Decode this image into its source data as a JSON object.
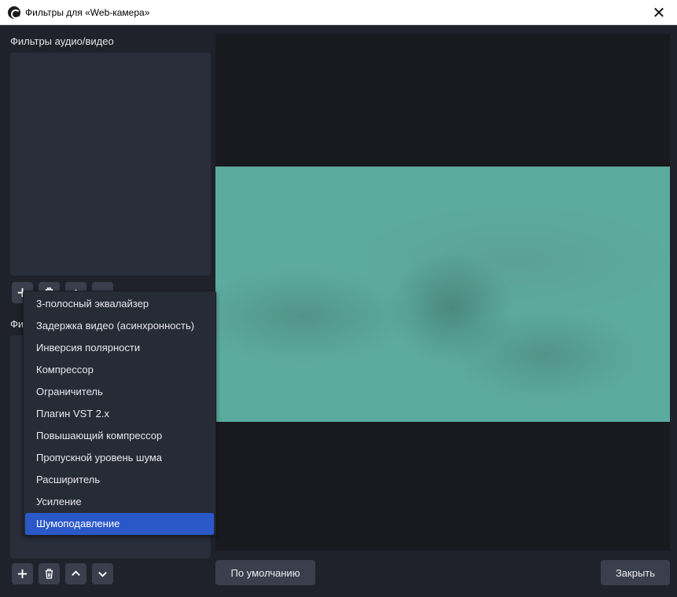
{
  "window": {
    "title": "Фильтры для «Web-камера»",
    "close_glyph": "✕"
  },
  "left_panel": {
    "audio_video_label": "Фильтры аудио/видео",
    "effects_label_partial": "Фи"
  },
  "add_menu": {
    "items": [
      "3-полосный эквалайзер",
      "Задержка видео (асинхронность)",
      "Инверсия полярности",
      "Компрессор",
      "Ограничитель",
      "Плагин VST 2.x",
      "Повышающий компрессор",
      "Пропускной уровень шума",
      "Расширитель",
      "Усиление",
      "Шумоподавление"
    ],
    "selected_index": 10
  },
  "buttons": {
    "defaults": "По умолчанию",
    "close": "Закрыть"
  },
  "icons": {
    "add": "plus-icon",
    "remove": "trash-icon",
    "up": "chevron-up-icon",
    "down": "chevron-down-icon"
  },
  "colors": {
    "background": "#1f222b",
    "panel": "#2a2e3a",
    "button": "#3b3f4d",
    "selection": "#2b58c9",
    "video_tint": "#5cab9f"
  }
}
